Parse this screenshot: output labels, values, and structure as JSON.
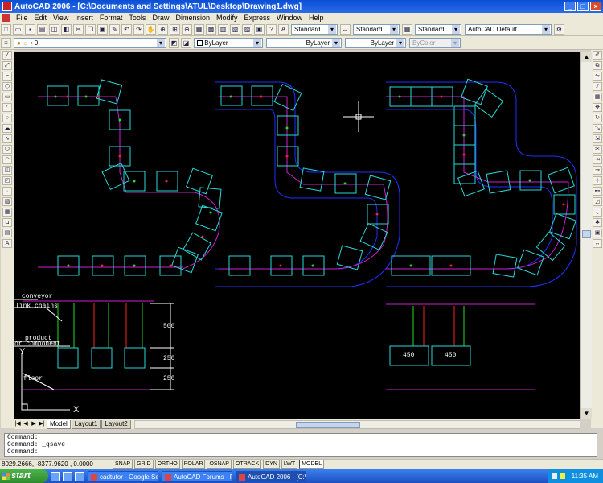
{
  "window": {
    "title": "AutoCAD 2006 - [C:\\Documents and Settings\\ATUL\\Desktop\\Drawing1.dwg]",
    "minimize_label": "_",
    "maximize_label": "□",
    "close_label": "×"
  },
  "menu": [
    "File",
    "Edit",
    "View",
    "Insert",
    "Format",
    "Tools",
    "Draw",
    "Dimension",
    "Modify",
    "Express",
    "Window",
    "Help"
  ],
  "toolbar": {
    "text_style": "Standard",
    "dim_style": "Standard",
    "table_style": "Standard",
    "workspace": "AutoCAD Default",
    "layer": "0",
    "color": "ByLayer",
    "linetype": "ByLayer",
    "lineweight": "ByLayer",
    "plotstyle": "ByColor"
  },
  "drawing": {
    "labels": {
      "conveyor": "conveyor",
      "link_chains": "link chains",
      "product": "product",
      "or_component": "or component",
      "floor": "floor",
      "axis_y": "Y",
      "axis_x": "X"
    },
    "dims": {
      "d500": "500",
      "d250a": "250",
      "d250b": "250",
      "w450a": "450",
      "w450b": "450"
    }
  },
  "tabs": [
    "Model",
    "Layout1",
    "Layout2"
  ],
  "command": {
    "lines": [
      "Command:",
      "Command: _qsave",
      "Command:"
    ]
  },
  "status": {
    "coords": "8029.2666, -8377.9620 , 0.0000",
    "toggles": [
      {
        "label": "SNAP",
        "on": false
      },
      {
        "label": "GRID",
        "on": false
      },
      {
        "label": "ORTHO",
        "on": false
      },
      {
        "label": "POLAR",
        "on": false
      },
      {
        "label": "OSNAP",
        "on": false
      },
      {
        "label": "OTRACK",
        "on": false
      },
      {
        "label": "DYN",
        "on": false
      },
      {
        "label": "LWT",
        "on": false
      },
      {
        "label": "MODEL",
        "on": true
      }
    ]
  },
  "taskbar": {
    "start": "start",
    "tasks": [
      {
        "label": "cadtutor - Google Se..."
      },
      {
        "label": "AutoCAD Forums - Po..."
      },
      {
        "label": "AutoCAD 2006 - [C:\\..."
      }
    ],
    "clock": "11:35 AM"
  },
  "colors": {
    "cyan": "#2ad9d9",
    "magenta": "#d020d0",
    "red": "#ff2020",
    "green": "#20e020",
    "blue": "#2030ff",
    "white": "#ffffff",
    "title_blue": "#0a4fd4",
    "taskbar_blue": "#245edb",
    "start_green": "#3c9a3c"
  }
}
